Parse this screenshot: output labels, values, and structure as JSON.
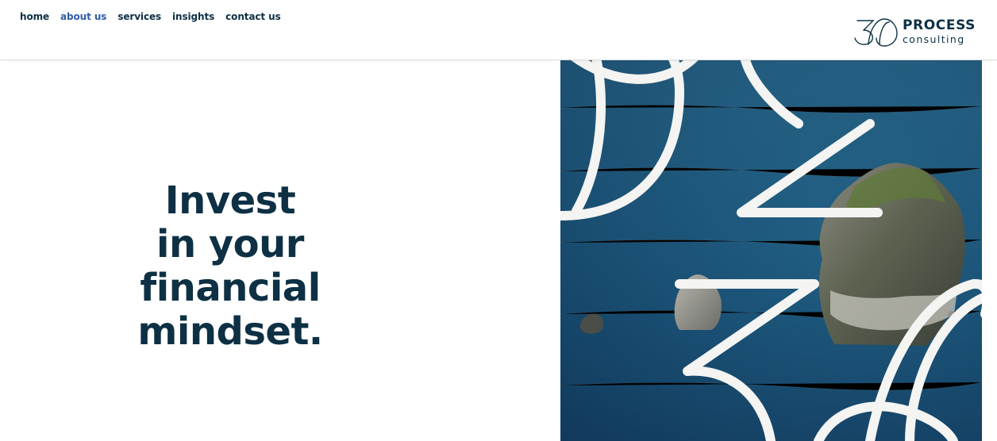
{
  "nav": {
    "items": [
      {
        "label": "home",
        "active": false
      },
      {
        "label": "about us",
        "active": true
      },
      {
        "label": "services",
        "active": false
      },
      {
        "label": "insights",
        "active": false
      },
      {
        "label": "contact us",
        "active": false
      }
    ]
  },
  "logo": {
    "word": "PROCESS",
    "sub": "consulting",
    "mark_text": "30"
  },
  "hero": {
    "lines": [
      "Invest",
      "in your",
      "financial",
      "mindset."
    ]
  },
  "colors": {
    "text": "#0d3044",
    "nav_active": "#2f5ca8",
    "sea": "#1f5c80",
    "overlay_stroke": "#f4f4f2"
  }
}
